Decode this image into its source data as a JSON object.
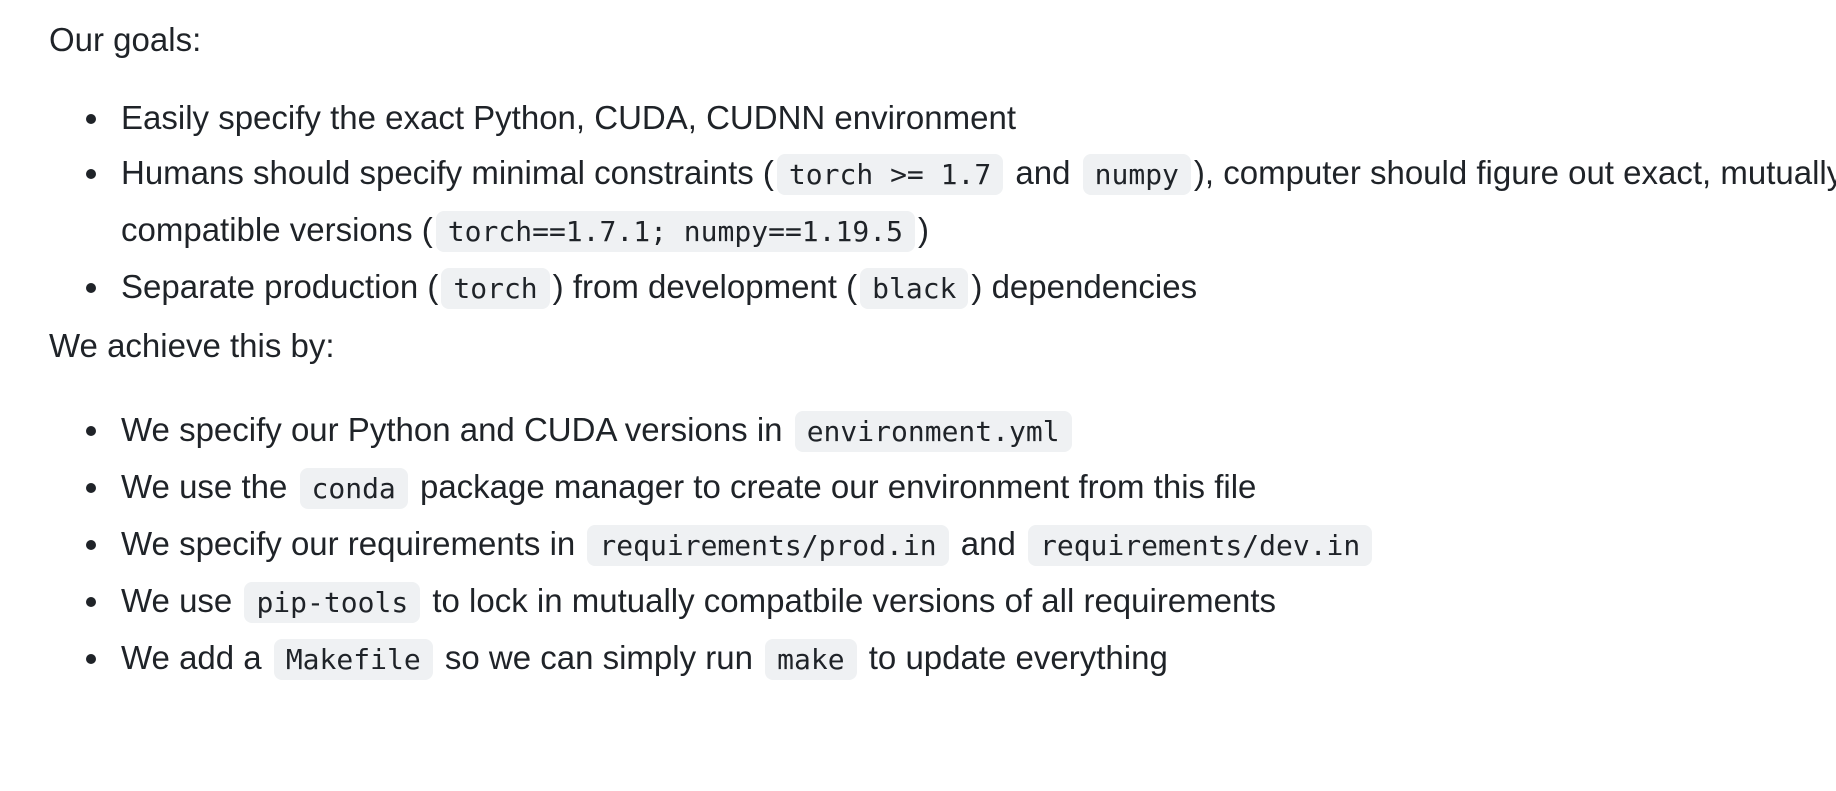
{
  "goals": {
    "heading": "Our goals:",
    "items": [
      {
        "t1": "Easily specify the exact Python, CUDA, CUDNN environment"
      },
      {
        "t1": "Humans should specify minimal constraints (",
        "c1": "torch >= 1.7",
        "t2": " and ",
        "c2": "numpy",
        "t3": "), computer should figure out exact, mutually compatible versions (",
        "c3": "torch==1.7.1; numpy==1.19.5",
        "t4": ")"
      },
      {
        "t1": "Separate production (",
        "c1": "torch",
        "t2": ") from development (",
        "c2": "black",
        "t3": ") dependencies"
      }
    ]
  },
  "approach": {
    "heading": "We achieve this by:",
    "items": [
      {
        "t1": "We specify our Python and CUDA versions in ",
        "c1": "environment.yml"
      },
      {
        "t1": "We use the ",
        "c1": "conda",
        "t2": " package manager to create our environment from this file"
      },
      {
        "t1": "We specify our requirements in ",
        "c1": "requirements/prod.in",
        "t2": " and ",
        "c2": "requirements/dev.in"
      },
      {
        "t1": "We use ",
        "c1": "pip-tools",
        "t2": " to lock in mutually compatbile versions of all requirements"
      },
      {
        "t1": "We add a ",
        "c1": "Makefile",
        "t2": " so we can simply run ",
        "c2": "make",
        "t3": " to update everything"
      }
    ]
  }
}
